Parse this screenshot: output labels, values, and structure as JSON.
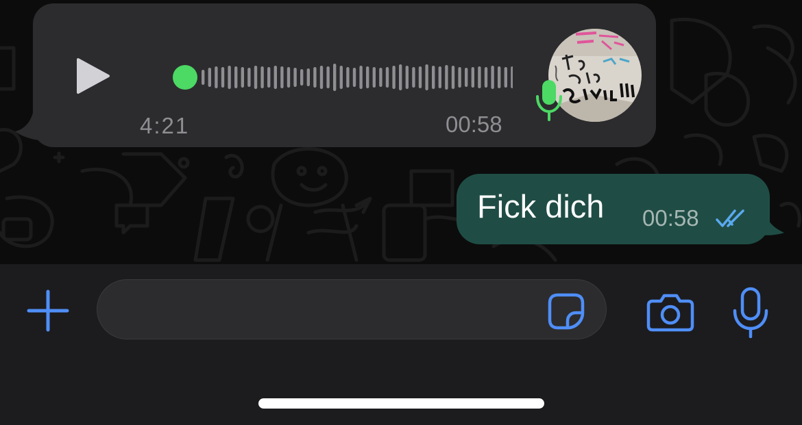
{
  "conversation": {
    "incoming_voice": {
      "duration": "4:21",
      "time": "00:58",
      "playback_progress": 0.0
    },
    "outgoing_text": {
      "text": "Fick dich",
      "time": "00:58",
      "status": "read"
    }
  },
  "composer": {
    "placeholder": "",
    "value": ""
  },
  "icons": {
    "play": "play-icon",
    "mic_badge": "microphone-icon",
    "read_receipt": "double-check-icon",
    "attach": "plus-icon",
    "sticker": "sticker-icon",
    "camera": "camera-icon",
    "voice": "microphone-icon"
  },
  "colors": {
    "accent_blue": "#4f8ef7",
    "voice_green": "#4cd964",
    "outgoing_bubble": "#1f4d45",
    "incoming_bubble": "#2c2c2e",
    "read_tick": "#5aa9f0"
  }
}
